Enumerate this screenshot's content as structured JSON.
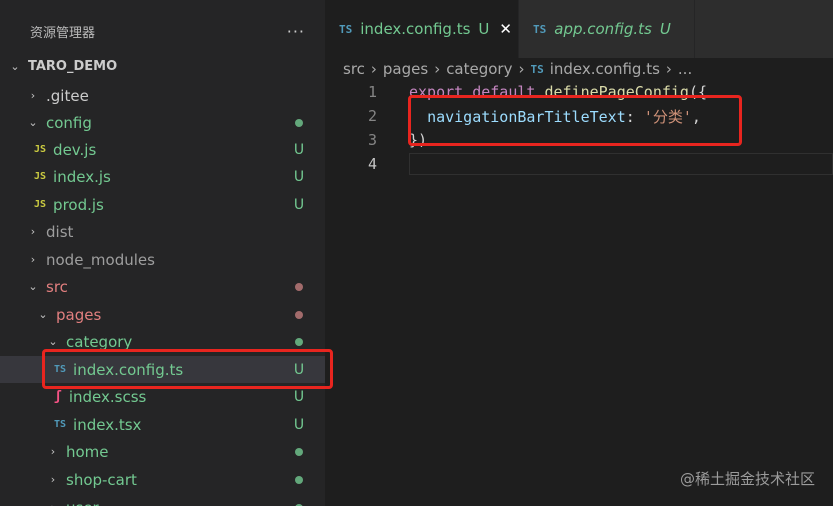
{
  "sidebar": {
    "title": "资源管理器",
    "more": "···",
    "root": "TARO_DEMO",
    "items": [
      {
        "label": ".gitee"
      },
      {
        "label": "config"
      },
      {
        "icon": "JS",
        "label": "dev.js",
        "status": "U"
      },
      {
        "icon": "JS",
        "label": "index.js",
        "status": "U"
      },
      {
        "icon": "JS",
        "label": "prod.js",
        "status": "U"
      },
      {
        "label": "dist"
      },
      {
        "label": "node_modules"
      },
      {
        "label": "src"
      },
      {
        "label": "pages"
      },
      {
        "label": "category"
      },
      {
        "icon": "TS",
        "label": "index.config.ts",
        "status": "U"
      },
      {
        "label": "index.scss",
        "status": "U"
      },
      {
        "icon": "TS",
        "label": "index.tsx",
        "status": "U"
      },
      {
        "label": "home"
      },
      {
        "label": "shop-cart"
      },
      {
        "label": "user"
      }
    ]
  },
  "tabs": [
    {
      "icon": "TS",
      "label": "index.config.ts",
      "status": "U",
      "close": "✕"
    },
    {
      "icon": "TS",
      "label": "app.config.ts",
      "status": "U"
    }
  ],
  "breadcrumb": {
    "parts": [
      "src",
      "pages",
      "category"
    ],
    "file_icon": "TS",
    "file": "index.config.ts",
    "tail": "..."
  },
  "editor": {
    "lines": [
      {
        "num": "1",
        "t1": "export",
        "t2": "default",
        "t3": "definePageConfig",
        "t4": "({"
      },
      {
        "num": "2",
        "prop": "navigationBarTitleText",
        "colon": ": ",
        "str": "'分类'",
        "comma": ","
      },
      {
        "num": "3",
        "text": "})"
      },
      {
        "num": "4"
      }
    ]
  },
  "watermark": "@稀土掘金技术社区",
  "colors": {
    "highlight": "#e8251f",
    "git_untracked": "#73c991",
    "ts_icon": "#519aba",
    "js_icon": "#cbcb41"
  }
}
